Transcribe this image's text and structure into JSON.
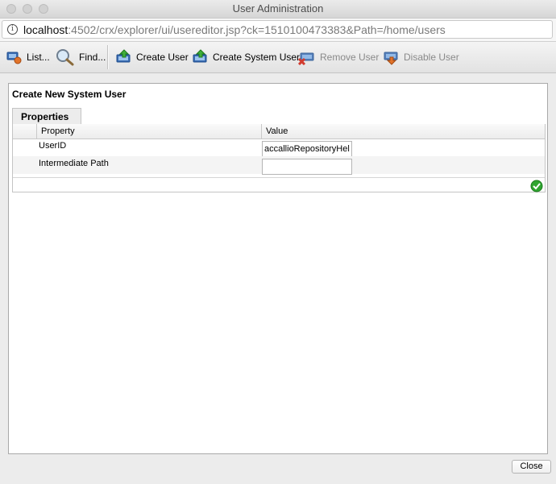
{
  "window": {
    "title": "User Administration"
  },
  "address_bar": {
    "host": "localhost",
    "rest": ":4502/crx/explorer/ui/usereditor.jsp?ck=1510100473383&Path=/home/users"
  },
  "toolbar": {
    "list_label": "List...",
    "find_label": "Find...",
    "create_user_label": "Create User",
    "create_system_user_label": "Create System User",
    "remove_user_label": "Remove User",
    "disable_user_label": "Disable User"
  },
  "panel": {
    "title": "Create New System User",
    "tab_label": "Properties",
    "columns": [
      "Property",
      "Value"
    ],
    "rows": [
      {
        "property": "UserID",
        "value": "accallioRepositoryHelper"
      },
      {
        "property": "Intermediate Path",
        "value": ""
      }
    ]
  },
  "footer": {
    "close_label": "Close"
  },
  "colors": {
    "enabled_text": "#000000",
    "disabled_text": "#8a8a8a",
    "confirm_green": "#2fa530"
  }
}
